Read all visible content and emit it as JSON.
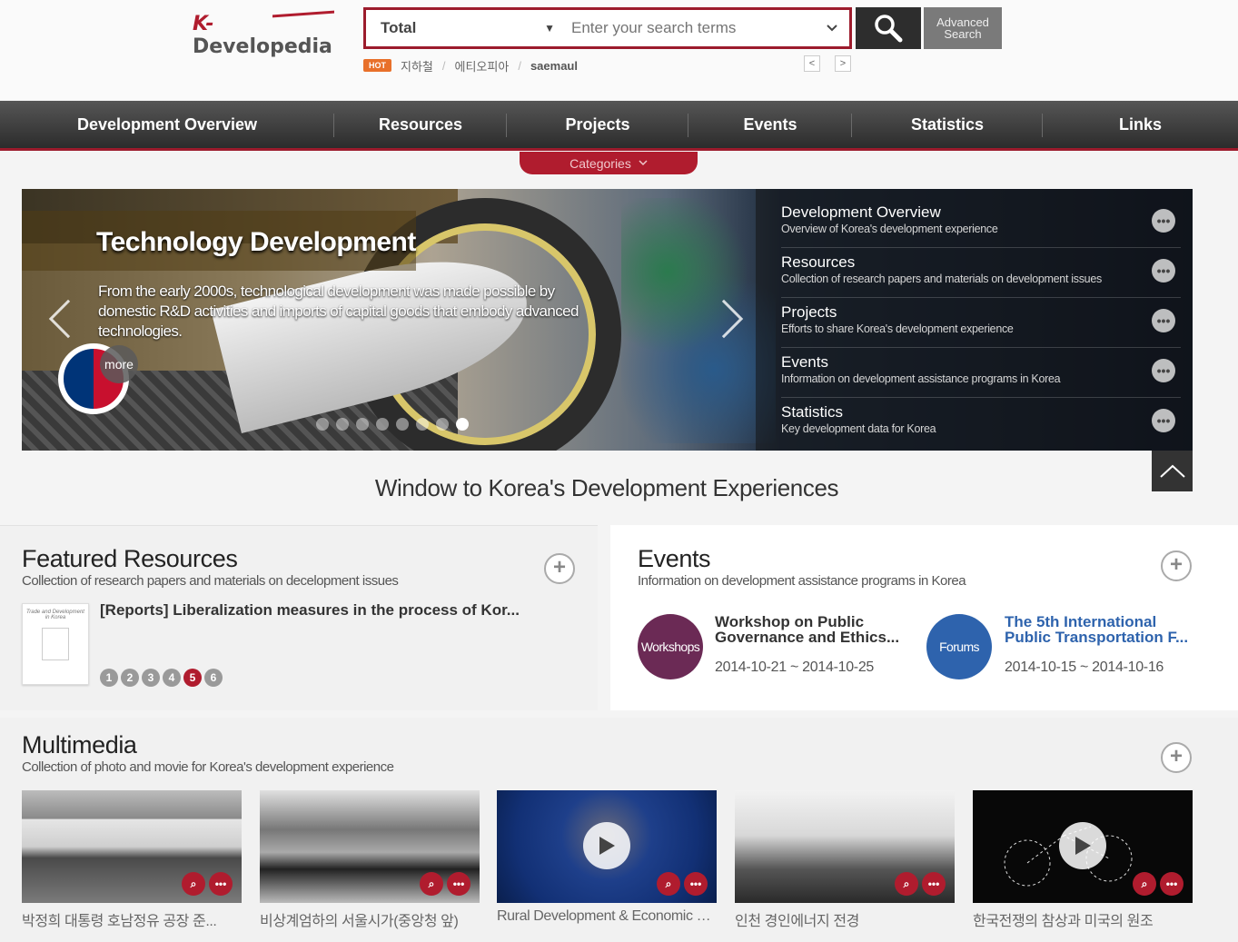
{
  "header": {
    "logo_prefix": "K-",
    "logo_text": "Developedia",
    "search": {
      "scope": "Total",
      "placeholder": "Enter your search terms"
    },
    "advanced_search_line1": "Advanced",
    "advanced_search_line2": "Search",
    "hot_badge": "HOT",
    "hot_keywords": [
      "지하철",
      "에티오피아",
      "saemaul"
    ],
    "separator": "/",
    "prev": "<",
    "next": ">"
  },
  "nav": {
    "items": [
      "Development Overview",
      "Resources",
      "Projects",
      "Events",
      "Statistics",
      "Links"
    ],
    "categories_label": "Categories"
  },
  "hero": {
    "title": "Technology Development",
    "text": "From the early 2000s, technological development was made possible by domestic R&D activities and imports of capital goods that embody advanced technologies.",
    "more_label": "more",
    "slide_count": 8,
    "active_slide": 8,
    "menu": [
      {
        "title": "Development Overview",
        "sub": "Overview of Korea's development experience"
      },
      {
        "title": "Resources",
        "sub": "Collection of research papers and materials on development issues"
      },
      {
        "title": "Projects",
        "sub": "Efforts to share Korea's development experience"
      },
      {
        "title": "Events",
        "sub": "Information on development assistance programs in Korea"
      },
      {
        "title": "Statistics",
        "sub": "Key development data for Korea"
      }
    ],
    "menu_more": "•••"
  },
  "tagline": "Window to Korea's Development Experiences",
  "featured": {
    "title": "Featured Resources",
    "sub": "Collection of research papers and materials on decelopment issues",
    "item_title": "[Reports] Liberalization measures in the process of Kor...",
    "thumb_title": "Trade and Development in Korea",
    "pages": [
      "1",
      "2",
      "3",
      "4",
      "5",
      "6"
    ],
    "active_page": 5
  },
  "events": {
    "title": "Events",
    "sub": "Information on development assistance programs in Korea",
    "items": [
      {
        "badge": "Workshops",
        "badge_color": "#6b2a55",
        "title_line1": "Workshop on Public",
        "title_line2": "Governance and Ethics...",
        "title_color": "#333333",
        "date": "2014-10-21 ~ 2014-10-25"
      },
      {
        "badge": "Forums",
        "badge_color": "#2e63ad",
        "title_line1": "The 5th International",
        "title_line2": "Public Transportation F...",
        "title_color": "#2e63ad",
        "date": "2014-10-15 ~ 2014-10-16"
      }
    ]
  },
  "multimedia": {
    "title": "Multimedia",
    "sub": "Collection of photo and movie for Korea's development experience",
    "items": [
      {
        "caption": "박정희 대통령 호남정유 공장 준...",
        "video": false
      },
      {
        "caption": "비상계엄하의 서울시가(중앙청 앞)",
        "video": false
      },
      {
        "caption": "Rural Development & Economic D...",
        "video": true
      },
      {
        "caption": "인천 경인에너지 전경",
        "video": false
      },
      {
        "caption": "한국전쟁의 참상과 미국의 원조",
        "video": true
      }
    ],
    "more_icon": "•••"
  },
  "colors": {
    "accent": "#b01c2e",
    "nav_dark": "#2c2c2c"
  }
}
